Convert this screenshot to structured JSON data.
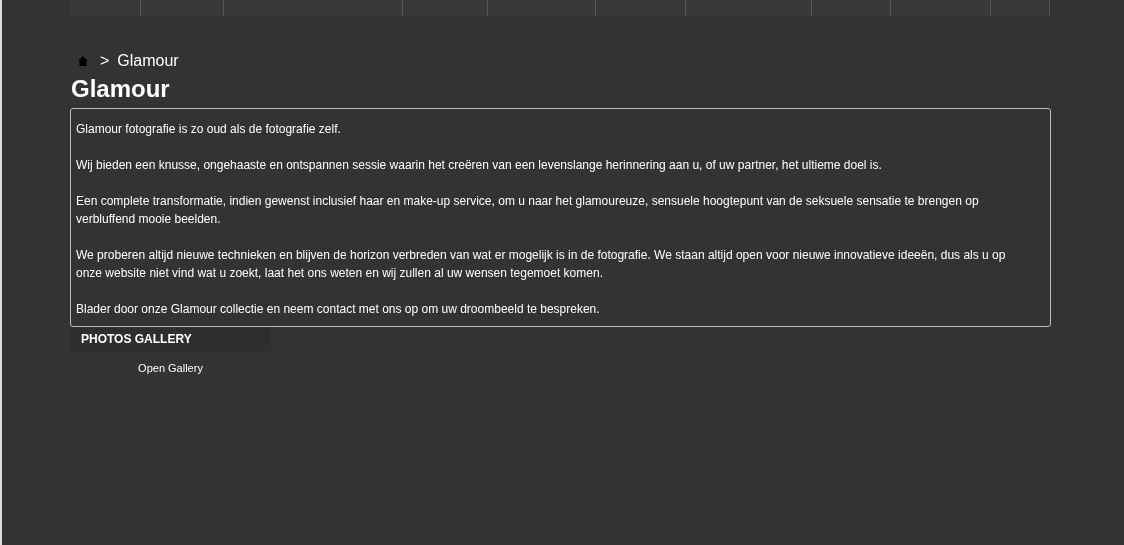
{
  "breadcrumb": {
    "separator": ">",
    "current": "Glamour"
  },
  "title": "Glamour",
  "paragraphs": [
    "Glamour fotografie is zo oud als de fotografie zelf.",
    "Wij bieden een knusse, ongehaaste en ontspannen sessie waarin het creëren van een levenslange herinnering aan u, of uw partner, het ultieme doel is.",
    "Een complete transformatie, indien gewenst inclusief haar en make-up service, om u naar het glamoureuze, sensuele hoogtepunt van de seksuele sensatie te brengen op verbluffend mooie beelden.",
    "We proberen altijd nieuwe technieken en blijven de horizon verbreden van wat er mogelijk is in de fotografie. We staan altijd open voor nieuwe innovatieve ideeën, dus als u op onze website niet vind wat u zoekt, laat het ons weten en wij zullen al uw wensen tegemoet komen.",
    "Blader door onze Glamour collectie en neem contact met ons op om uw droombeeld te bespreken."
  ],
  "gallery": {
    "heading": "PHOTOS GALLERY",
    "link": "Open Gallery"
  }
}
